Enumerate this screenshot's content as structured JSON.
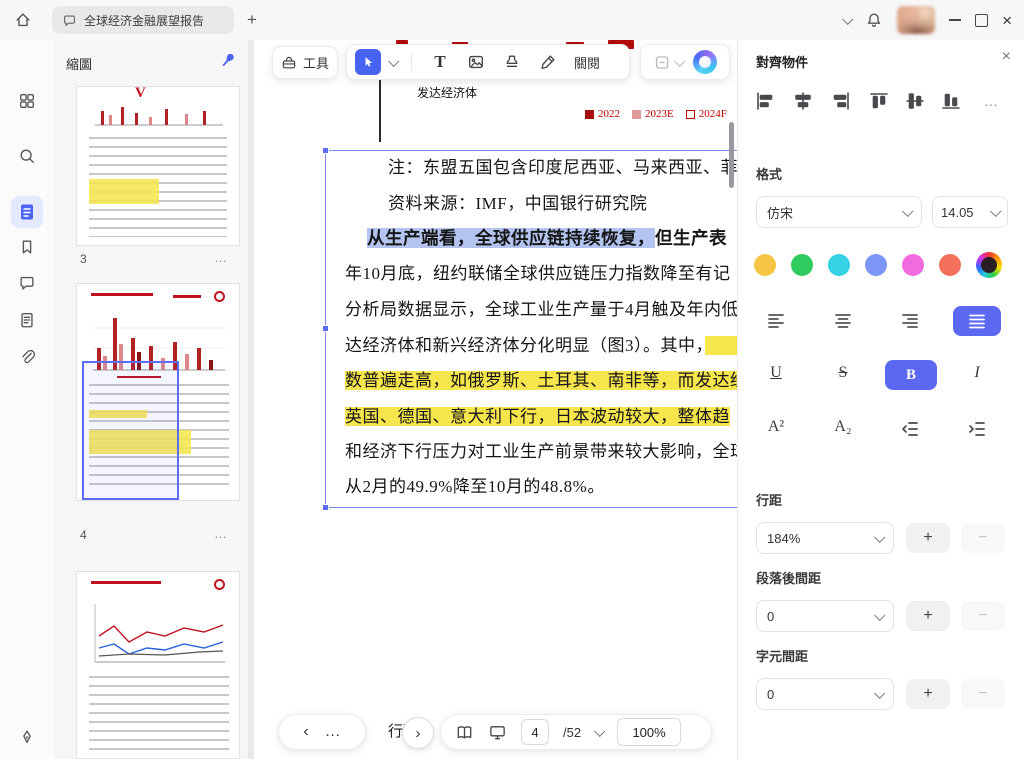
{
  "titlebar": {
    "tab_title": "全球经济金融展望报告",
    "plus": "+",
    "close_glyph": "×"
  },
  "thumbs": {
    "title": "縮圖",
    "page3": "3",
    "page4": "4",
    "more": "…"
  },
  "toolbar": {
    "tools": "工具",
    "text_tool": "T",
    "review": "關閱"
  },
  "doc": {
    "axis_label": "发达经济体",
    "legend1": "2022",
    "legend2": "2023E",
    "legend3": "2024F",
    "lines": [
      {
        "a": "注：东盟五国包含印度尼西亚、马来西亚、菲",
        "b": ""
      },
      {
        "a": "资料来源：IMF，中国银行研究院",
        "b": ""
      },
      {
        "a": "从生产端看，全球供应链持续恢复，",
        "b": "但生产表"
      },
      {
        "a": "年10月底，纽约联储全球供应链压力指数降至有记",
        "b": ""
      },
      {
        "a": "分析局数据显示，全球工业生产量于4月触及年内低",
        "b": ""
      },
      {
        "a": "达经济体和新兴经济体分化明显（图3）。其中，",
        "b": "　　"
      },
      {
        "a": "数普遍走高，如俄罗斯、土耳其、南非等，而发达经",
        "b": ""
      },
      {
        "a": "英国、德国、意大利下行，日本波动较大，整体趋",
        "b": ""
      },
      {
        "a": "和经济下行压力对工业生产前景带来较大影响，全球",
        "b": ""
      },
      {
        "a": "从2月的49.9%降至10月的48.8%。",
        "b": ""
      }
    ],
    "fragment": "行礦"
  },
  "bottombar": {
    "prev": "‹",
    "more": "…",
    "next": "›",
    "page": "4",
    "total": "/52",
    "zoom": "100%"
  },
  "panel": {
    "title": "對齊物件",
    "close": "×",
    "more": "…",
    "format": "格式",
    "font": "仿宋",
    "size": "14.05",
    "u": "U",
    "s": "S",
    "b": "B",
    "i": "I",
    "sup": "A²",
    "sub": "A₂",
    "line_spacing_label": "行距",
    "line_spacing": "184%",
    "para_label": "段落後間距",
    "para": "0",
    "char_label": "字元間距",
    "char": "0",
    "plus": "+",
    "minus": "−"
  }
}
